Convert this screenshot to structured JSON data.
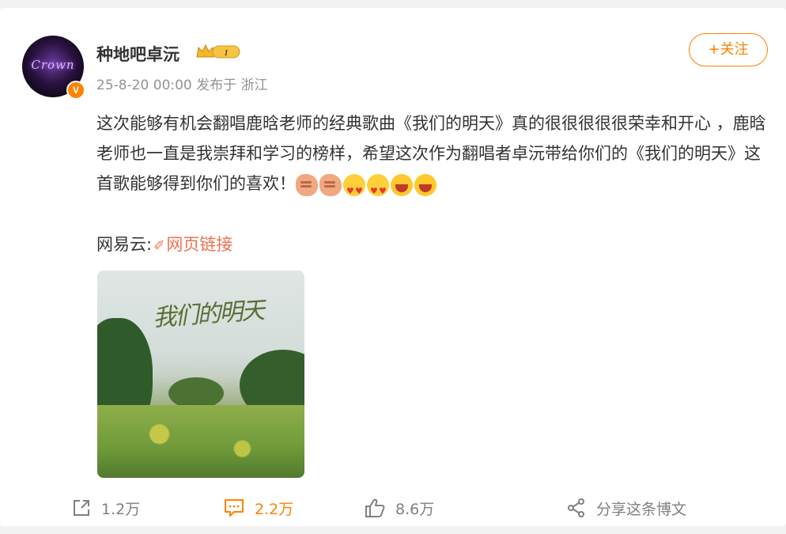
{
  "post": {
    "username": "种地吧卓沅",
    "meta": "25-8-20 00:00 发布于 浙江",
    "follow_label": "+关注",
    "text": "这次能够有机会翻唱鹿晗老师的经典歌曲《我们的明天》真的很很很很很荣幸和开心 ，鹿晗老师也一直是我崇拜和学习的榜样，希望这次作为翻唱者卓沅带给你们的《我们的明天》这首歌能够得到你们的喜欢！",
    "link_prefix": "网易云:",
    "link_label": "网页链接",
    "cover_title": "我们的明天",
    "avatar_text": "Crown",
    "verified_badge": "V",
    "level_badge": "I"
  },
  "actions": {
    "share_count": "1.2万",
    "comment_count": "2.2万",
    "like_count": "8.6万",
    "share_post_label": "分享这条博文"
  },
  "colors": {
    "accent": "#ff8200",
    "link": "#eb7350",
    "muted": "#939393"
  },
  "icons": [
    "share-icon",
    "comment-icon",
    "like-icon",
    "share-post-icon",
    "link-icon",
    "crown-icon"
  ]
}
